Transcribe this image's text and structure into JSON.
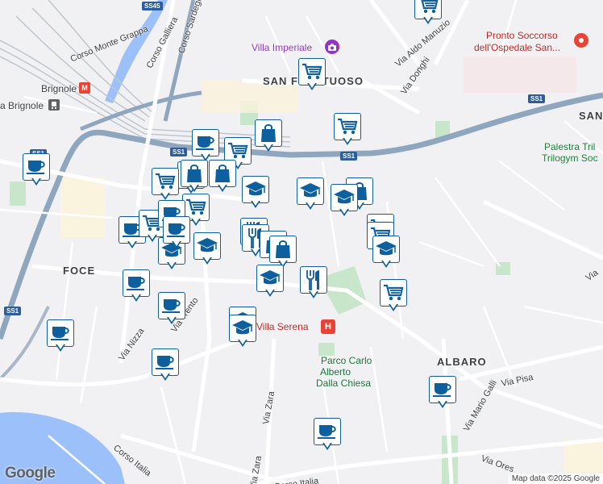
{
  "labels": {
    "corso_monte_grappa": "Corso Monte Grappa",
    "corso_galliera": "Corso Galliera",
    "corso_sardegna": "Corso Sardegna",
    "villa_imperiale": "Villa Imperiale",
    "san_fruttuoso": "SAN FRUTTUOSO",
    "via_aldo_manuzio": "Via Aldo Manuzio",
    "via_donghi": "Via Donghi",
    "pronto_soccorso_1": "Pronto Soccorso",
    "pronto_soccorso_2": "dell'Ospedale San...",
    "brignole": "Brignole",
    "brignole_station": "a Brignole",
    "san_right": "SAN",
    "palestra_1": "Palestra Tril",
    "palestra_2": "Trilogym Soc",
    "foce": "FOCE",
    "via_nizza": "Via Nizza",
    "via_trento": "Via Trento",
    "villa_serena": "Villa Serena",
    "parco_1": "Parco Carlo",
    "parco_2": "Alberto",
    "parco_3": "Dalla Chiesa",
    "albaro": "ALBARO",
    "via_pisa": "Via Pisa",
    "via_mario_galli": "Via Mario Galli",
    "via_zara_1": "Via Zara",
    "via_zara_2": "Via Zara",
    "corso_italia_1": "Corso Italia",
    "corso_italia_2": "Corso Italia",
    "via_oresi": "Via Ores",
    "via_right": "Via"
  },
  "shields": {
    "ss45": "SS45",
    "ss1_a": "SS1",
    "ss1_b": "SS1",
    "ss1_c": "SS1",
    "ss1_d": "SS1",
    "ss1_e": "SS1"
  },
  "colors": {
    "marker_blue": "#0d5f9e",
    "water": "#9cc0f9",
    "park": "#c8e6c9",
    "highway": "#8fa6bf",
    "rail": "#bfc6ce"
  },
  "markers": [
    {
      "icon": "shopping-cart"
    },
    {
      "icon": "coffee"
    },
    {
      "icon": "shopping-bag"
    },
    {
      "icon": "shopping-cart"
    },
    {
      "icon": "coffee"
    },
    {
      "icon": "shopping-cart"
    },
    {
      "icon": "shopping-bag"
    },
    {
      "icon": "coffee"
    },
    {
      "icon": "restaurant"
    },
    {
      "icon": "shopping-bag"
    },
    {
      "icon": "shopping-cart"
    },
    {
      "icon": "shopping-cart"
    },
    {
      "icon": "school"
    },
    {
      "icon": "school"
    },
    {
      "icon": "school"
    },
    {
      "icon": "shopping-bag"
    },
    {
      "icon": "shopping-cart"
    },
    {
      "icon": "shopping-cart"
    },
    {
      "icon": "coffee"
    },
    {
      "icon": "shopping-cart"
    },
    {
      "icon": "school"
    },
    {
      "icon": "school"
    },
    {
      "icon": "shopping-cart"
    },
    {
      "icon": "restaurant"
    },
    {
      "icon": "restaurant"
    },
    {
      "icon": "shopping-bag"
    },
    {
      "icon": "shopping-bag"
    },
    {
      "icon": "school"
    },
    {
      "icon": "restaurant"
    },
    {
      "icon": "school"
    },
    {
      "icon": "coffee"
    },
    {
      "icon": "shopping-cart"
    },
    {
      "icon": "coffee"
    },
    {
      "icon": "school"
    },
    {
      "icon": "school"
    },
    {
      "icon": "coffee"
    },
    {
      "icon": "coffee"
    },
    {
      "icon": "coffee"
    },
    {
      "icon": "coffee"
    },
    {
      "icon": "coffee"
    }
  ],
  "attribution": {
    "logo": "Google",
    "credit": "Map data ©2025 Google"
  }
}
